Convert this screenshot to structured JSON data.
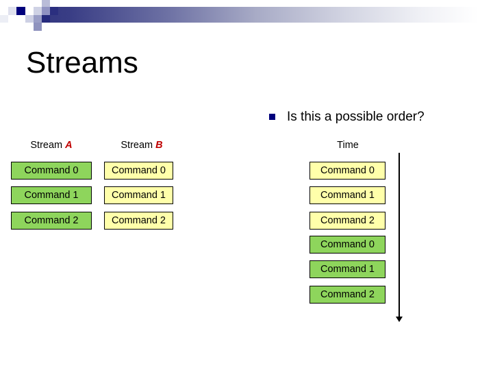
{
  "slide": {
    "title": "Streams",
    "bullet": {
      "marker": "square-bullet-icon",
      "text": "Is this a possible order?"
    }
  },
  "columns": {
    "stream_a": {
      "label_prefix": "Stream ",
      "label_letter": "A"
    },
    "stream_b": {
      "label_prefix": "Stream ",
      "label_letter": "B"
    },
    "time": {
      "label": "Time"
    }
  },
  "stream_a_commands": [
    {
      "label": "Command 0",
      "color": "#8ed55c"
    },
    {
      "label": "Command 1",
      "color": "#8ed55c"
    },
    {
      "label": "Command 2",
      "color": "#8ed55c"
    }
  ],
  "stream_b_commands": [
    {
      "label": "Command 0",
      "color": "#ffffaa"
    },
    {
      "label": "Command 1",
      "color": "#ffffaa"
    },
    {
      "label": "Command 2",
      "color": "#ffffaa"
    }
  ],
  "time_commands": [
    {
      "label": "Command 0",
      "color": "#ffffaa"
    },
    {
      "label": "Command 1",
      "color": "#ffffaa"
    },
    {
      "label": "Command 2",
      "color": "#ffffaa"
    },
    {
      "label": "Command 0",
      "color": "#8ed55c"
    },
    {
      "label": "Command 1",
      "color": "#8ed55c"
    },
    {
      "label": "Command 2",
      "color": "#8ed55c"
    }
  ],
  "colors": {
    "green_box": "#8ed55c",
    "yellow_box": "#ffffaa",
    "bullet_navy": "#00007c",
    "accent_red": "#c00000",
    "banner_dark": "#2b2f7a",
    "box_border": "#000000"
  },
  "time_axis": {
    "direction": "downward-arrow-icon"
  }
}
